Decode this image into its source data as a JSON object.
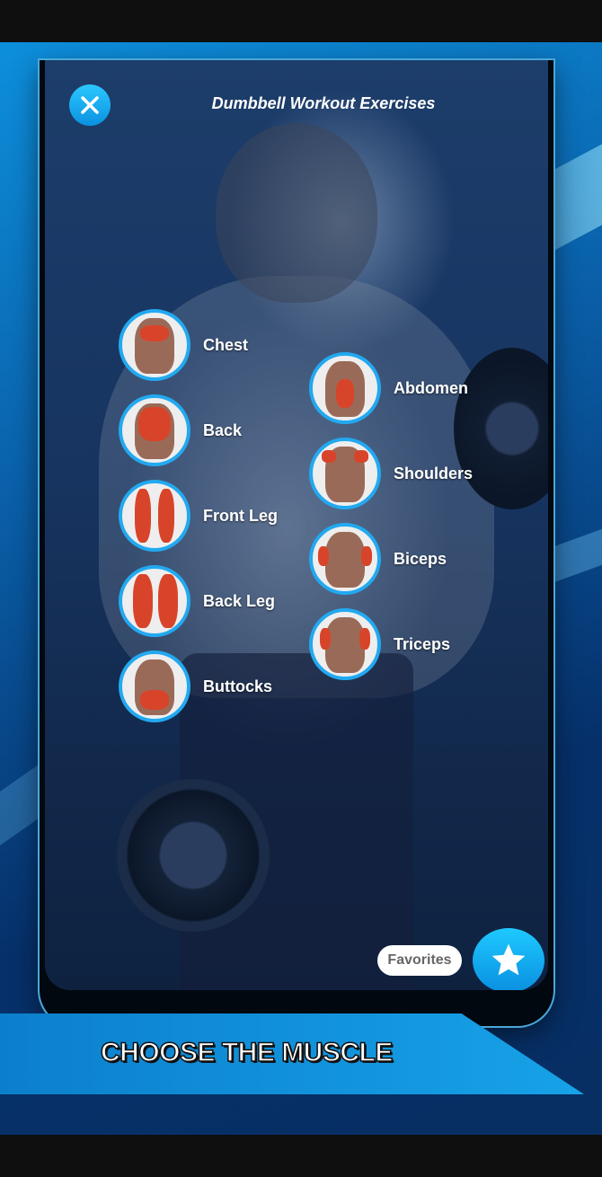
{
  "header": {
    "title": "Dumbbell Workout Exercises",
    "close_icon": "close-icon"
  },
  "muscles_left": [
    {
      "label": "Chest",
      "highlight": "chest"
    },
    {
      "label": "Back",
      "highlight": "back"
    },
    {
      "label": "Front Leg",
      "highlight": "front-leg"
    },
    {
      "label": "Back Leg",
      "highlight": "back-leg"
    },
    {
      "label": "Buttocks",
      "highlight": "buttocks"
    }
  ],
  "muscles_right": [
    {
      "label": "Abdomen",
      "highlight": "abdomen"
    },
    {
      "label": "Shoulders",
      "highlight": "shoulders"
    },
    {
      "label": "Biceps",
      "highlight": "biceps"
    },
    {
      "label": "Triceps",
      "highlight": "triceps"
    }
  ],
  "favorites": {
    "label": "Favorites",
    "icon": "star-icon"
  },
  "banner": {
    "text": "CHOOSE THE MUSCLE"
  },
  "colors": {
    "accent": "#22a9f0",
    "muscle_highlight": "#d8442a"
  }
}
